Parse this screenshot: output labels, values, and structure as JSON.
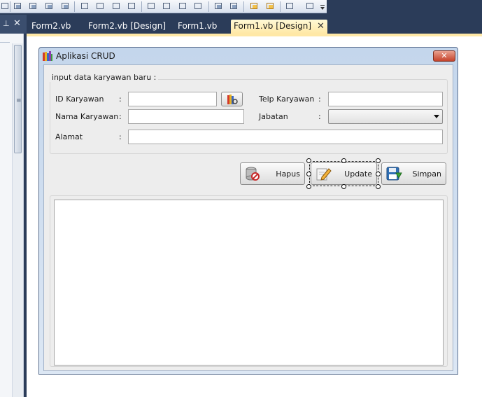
{
  "ide": {
    "tabs": [
      {
        "label": "Form2.vb",
        "active": false
      },
      {
        "label": "Form2.vb [Design]",
        "active": false
      },
      {
        "label": "Form1.vb",
        "active": false
      },
      {
        "label": "Form1.vb [Design]",
        "active": true
      }
    ],
    "left_pane": {
      "pin_icon": "pin-icon",
      "close_glyph": "✕"
    },
    "tab_close_glyph": "✕",
    "colors": {
      "chrome": "#2b3c59",
      "active_tab": "#ffe8a6"
    }
  },
  "form": {
    "title": "Aplikasi CRUD",
    "close_glyph": "✕",
    "group_title": "input data karyawan baru :",
    "fields": {
      "id_label": "ID Karyawan",
      "nama_label": "Nama Karyawan",
      "alamat_label": "Alamat",
      "telp_label": "Telp Karyawan",
      "jabatan_label": "Jabatan",
      "colon": ":"
    },
    "values": {
      "id": "",
      "nama": "",
      "alamat": "",
      "telp": "",
      "jabatan": ""
    },
    "buttons": {
      "hapus": "Hapus",
      "update": "Update",
      "simpan": "Simpan"
    },
    "selected_control": "Update"
  }
}
